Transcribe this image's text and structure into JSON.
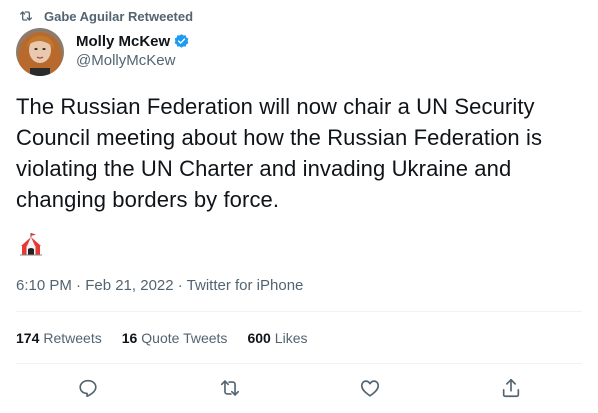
{
  "context": {
    "text": "Gabe Aguilar Retweeted",
    "icon": "retweet-icon"
  },
  "author": {
    "display_name": "Molly McKew",
    "handle": "@MollyMcKew",
    "verified": true,
    "verified_color": "#1d9bf0"
  },
  "tweet": {
    "text": "The Russian Federation will now chair a UN Security Council meeting about how the Russian Federation is violating the UN Charter and invading Ukraine and changing borders by force.",
    "emoji": "circus-tent-emoji",
    "timestamp": "6:10 PM · Feb 21, 2022 · Twitter for iPhone"
  },
  "stats": {
    "retweets_count": "174",
    "retweets_label": "Retweets",
    "quotes_count": "16",
    "quotes_label": "Quote Tweets",
    "likes_count": "600",
    "likes_label": "Likes"
  },
  "actions": [
    "reply-icon",
    "retweet-icon",
    "like-icon",
    "share-icon"
  ],
  "colors": {
    "text": "#0f1419",
    "secondary": "#536471",
    "divider": "#eff3f4"
  }
}
